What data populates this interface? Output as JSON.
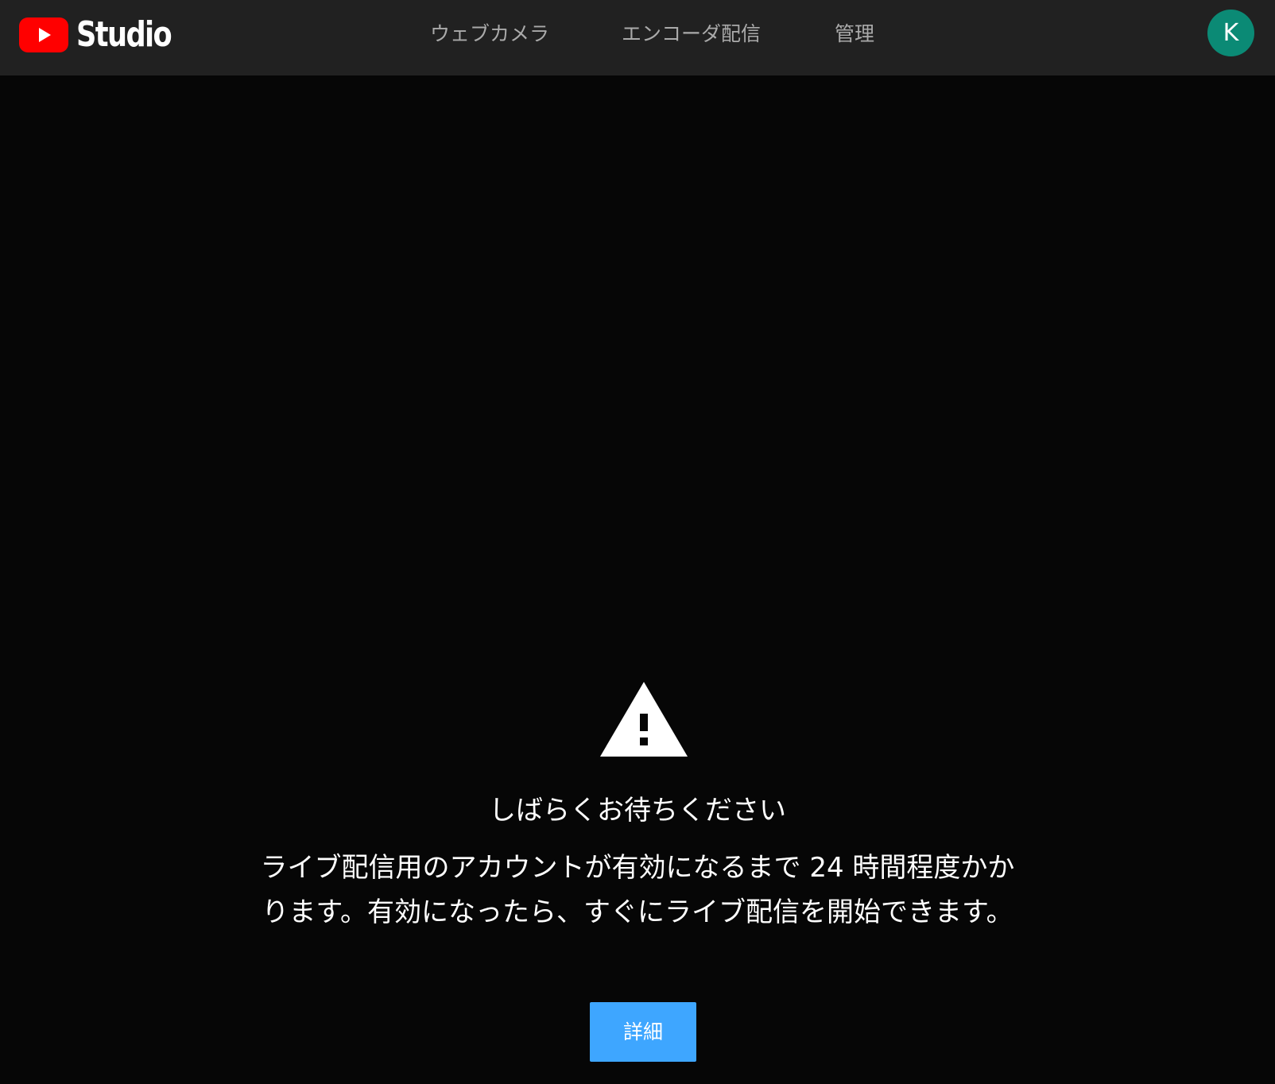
{
  "header": {
    "logo_text": "Studio",
    "logo_icon": "youtube-play-icon",
    "nav": [
      {
        "label": "ウェブカメラ"
      },
      {
        "label": "エンコーダ配信"
      },
      {
        "label": "管理"
      }
    ],
    "avatar_initial": "K"
  },
  "notice": {
    "icon": "warning-icon",
    "title": "しばらくお待ちください",
    "message": "ライブ配信用のアカウントが有効になるまで 24 時間程度かかります。有効になったら、すぐにライブ配信を開始できます。",
    "button_label": "詳細"
  },
  "colors": {
    "background": "#060606",
    "topbar": "#212121",
    "nav_text": "#aaaaaa",
    "youtube_red": "#ff0000",
    "avatar_bg": "#0b8a75",
    "button_bg": "#3ea6ff"
  }
}
